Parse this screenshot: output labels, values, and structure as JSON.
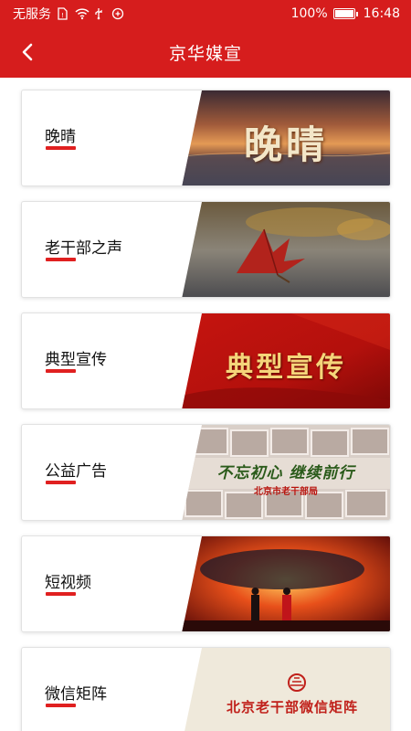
{
  "status_bar": {
    "carrier": "无服务",
    "battery": "100%",
    "time": "16:48",
    "battery_level": 1.0
  },
  "header": {
    "title": "京华媒宣"
  },
  "cards": [
    {
      "label": "晚晴",
      "thumb_text": "晚晴"
    },
    {
      "label": "老干部之声"
    },
    {
      "label": "典型宣传",
      "thumb_text": "典型宣传"
    },
    {
      "label": "公益广告",
      "thumb_text": "不忘初心 继续前行",
      "thumb_subtext": "北京市老干部局"
    },
    {
      "label": "短视频"
    },
    {
      "label": "微信矩阵",
      "thumb_text": "北京老干部微信矩阵"
    }
  ],
  "colors": {
    "brand_red": "#d61d1d",
    "underline_red": "#e02020"
  }
}
